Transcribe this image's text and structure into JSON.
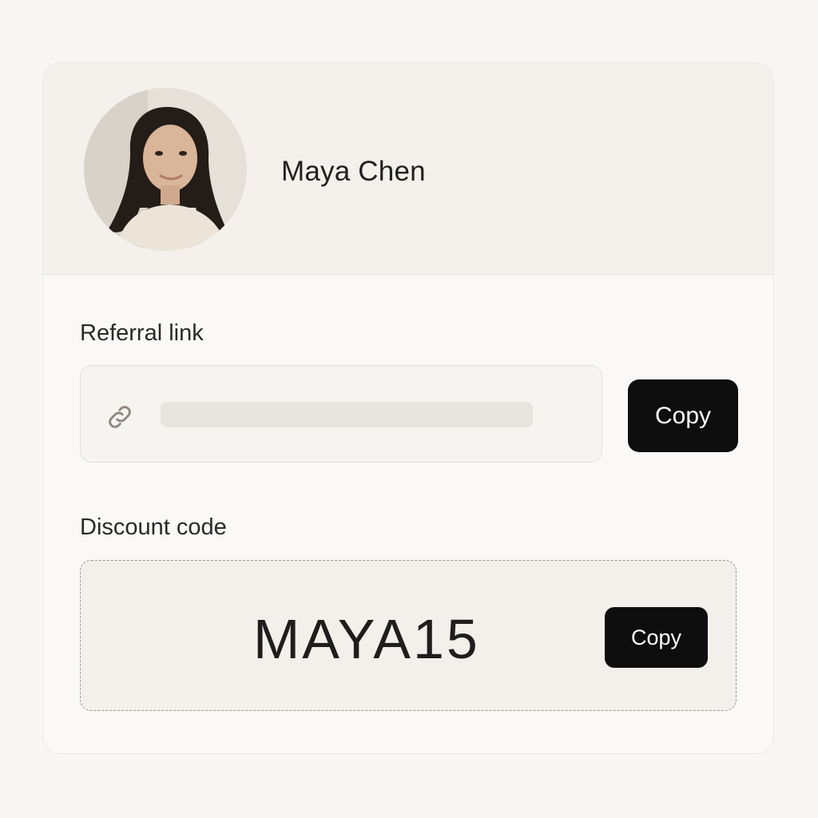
{
  "profile": {
    "name": "Maya Chen",
    "avatar_icon": "profile-photo"
  },
  "referral": {
    "label": "Referral link",
    "link_icon": "link-icon",
    "copy_label": "Copy"
  },
  "discount": {
    "label": "Discount code",
    "code": "MAYA15",
    "copy_label": "Copy"
  },
  "colors": {
    "button_bg": "#0e0e0e",
    "button_text": "#ffffff",
    "header_bg": "#f4f1ed",
    "page_bg": "#f8f7f5"
  }
}
